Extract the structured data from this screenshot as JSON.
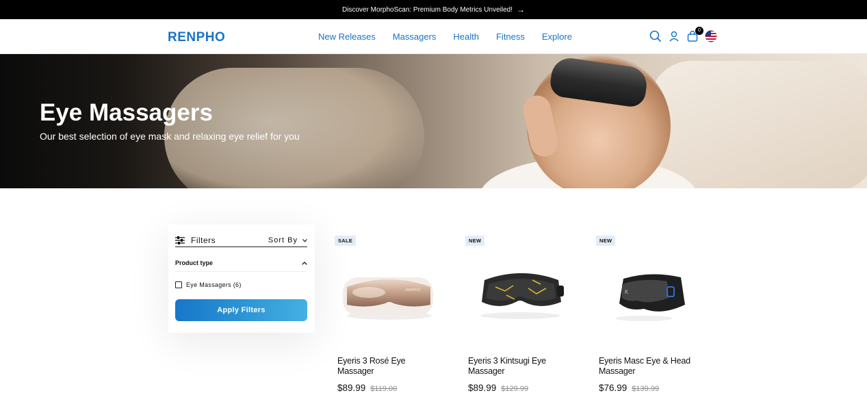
{
  "announcement": {
    "text": "Discover MorphoScan: Premium Body Metrics Unveiled!",
    "arrow": "→"
  },
  "header": {
    "logo": "RENPHO",
    "nav": [
      "New Releases",
      "Massagers",
      "Health",
      "Fitness",
      "Explore"
    ],
    "cart_count": "0",
    "icons": [
      "search-icon",
      "account-icon",
      "cart-icon",
      "us-flag-icon"
    ]
  },
  "hero": {
    "title": "Eye Massagers",
    "subtitle": "Our best selection of eye mask and relaxing eye relief for you"
  },
  "filters": {
    "label": "Filters",
    "sort_label": "Sort By",
    "section_title": "Product type",
    "options": [
      {
        "label": "Eye Massagers (6)",
        "checked": false
      }
    ],
    "apply_label": "Apply Filters"
  },
  "products": [
    {
      "badge": "SALE",
      "name": "Eyeris 3 Rosé Eye Massager",
      "price": "$89.99",
      "old_price": "$119.00",
      "image": "rose-gold-eye-massager"
    },
    {
      "badge": "NEW",
      "name": "Eyeris 3 Kintsugi Eye Massager",
      "price": "$89.99",
      "old_price": "$129.99",
      "image": "black-gold-eye-massager"
    },
    {
      "badge": "NEW",
      "name": "Eyeris Masc Eye & Head Massager",
      "price": "$76.99",
      "old_price": "$139.99",
      "image": "black-eye-head-massager"
    }
  ],
  "colors": {
    "brand_blue": "#1a73c8",
    "announcement_bg": "#000000",
    "badge_bg": "#e3ecf6"
  }
}
